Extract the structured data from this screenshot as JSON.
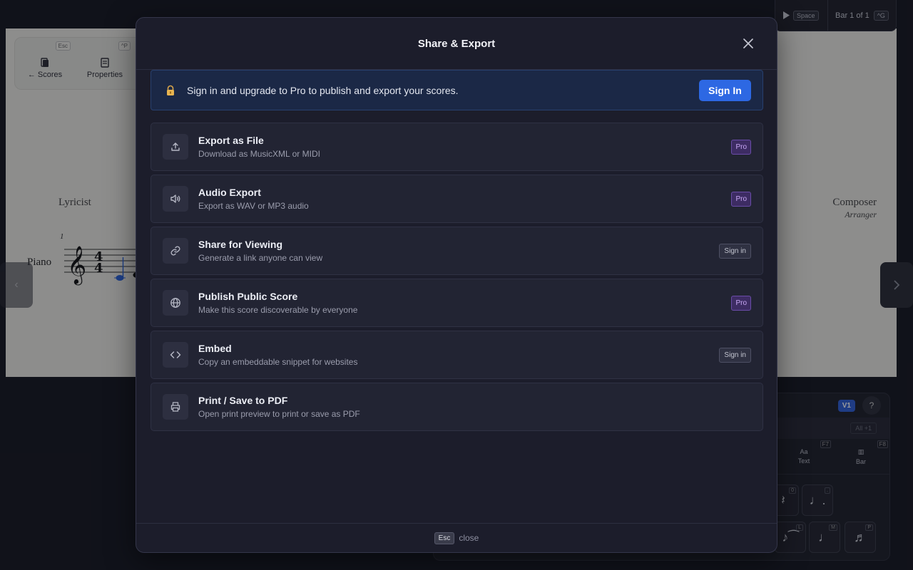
{
  "modal": {
    "title": "Share & Export",
    "banner": {
      "text": "Sign in and upgrade to Pro to publish and export your scores.",
      "button": "Sign In"
    },
    "options": [
      {
        "title": "Export as File",
        "desc": "Download as MusicXML or MIDI",
        "badge": "Pro",
        "badge_type": "pro",
        "icon": "upload-icon"
      },
      {
        "title": "Audio Export",
        "desc": "Export as WAV or MP3 audio",
        "badge": "Pro",
        "badge_type": "pro",
        "icon": "speaker-icon"
      },
      {
        "title": "Share for Viewing",
        "desc": "Generate a link anyone can view",
        "badge": "Sign in",
        "badge_type": "signin",
        "icon": "link-icon"
      },
      {
        "title": "Publish Public Score",
        "desc": "Make this score discoverable by everyone",
        "badge": "Pro",
        "badge_type": "pro",
        "icon": "globe-icon"
      },
      {
        "title": "Embed",
        "desc": "Copy an embeddable snippet for websites",
        "badge": "Sign in",
        "badge_type": "signin",
        "icon": "code-icon"
      },
      {
        "title": "Print / Save to PDF",
        "desc": "Open print preview to print or save as PDF",
        "badge": "",
        "badge_type": "none",
        "icon": "printer-icon"
      }
    ],
    "footer": {
      "key": "Esc",
      "text": "close"
    }
  },
  "toolbar": {
    "scores": {
      "label": "← Scores",
      "key": "Esc"
    },
    "properties": {
      "label": "Properties",
      "key": "^P"
    }
  },
  "score": {
    "lyricist": "Lyricist",
    "composer": "Composer",
    "arranger": "Arranger",
    "instrument": "Piano",
    "measure_number": "1",
    "time_signature": "4/4"
  },
  "playbar": {
    "play_key": "Space",
    "bar_text": "Bar 1 of 1",
    "bar_key": "^G"
  },
  "panel": {
    "voice": "V1",
    "help": "?",
    "select_value": "All +1",
    "tools": [
      {
        "label": "Text",
        "key": "F7"
      },
      {
        "label": "Bar",
        "key": "F8"
      }
    ],
    "note_keys": [
      "0",
      ".",
      "L",
      "M",
      "P"
    ]
  },
  "colors": {
    "accent": "#2d68e3",
    "pro_badge": "#3d2c63",
    "modal_bg": "#1c1d2b"
  }
}
